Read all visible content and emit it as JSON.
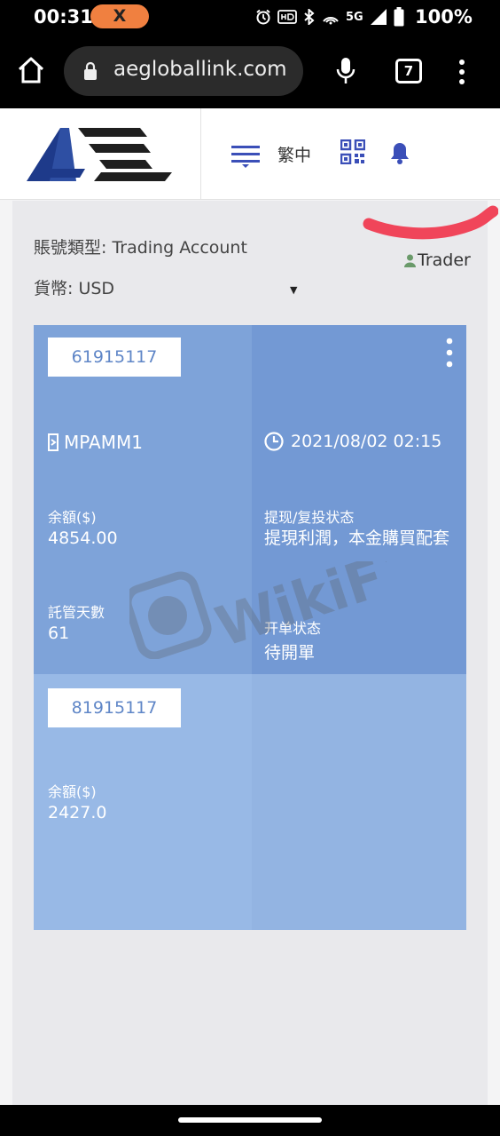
{
  "status_bar": {
    "time": "00:31",
    "notification_badge": "X",
    "network": "5G",
    "battery": "100%"
  },
  "browser": {
    "url": "aegloballink.com",
    "tab_count": "7"
  },
  "header": {
    "language": "繁中",
    "brand_color": "#1e3a8a",
    "accent_color": "#3b4fb8"
  },
  "account": {
    "type_label": "賬號類型:",
    "type_value": "Trading Account",
    "currency_label": "貨幣:",
    "currency_value": "USD",
    "role": "Trader"
  },
  "cards": [
    {
      "account_number": "61915117",
      "fund_name": "MPAMM1",
      "datetime": "2021/08/02 02:15",
      "balance_label": "余額($)",
      "balance": "4854.00",
      "withdraw_label": "提现/复投状态",
      "withdraw_value": "提現利潤，本金購買配套",
      "days_label": "託管天數",
      "days": "61",
      "order_status_label": "开单状态",
      "order_status": "待開單"
    },
    {
      "account_number": "81915117",
      "balance_label": "余額($)",
      "balance": "2427.0"
    }
  ],
  "watermark": "WikiFX"
}
